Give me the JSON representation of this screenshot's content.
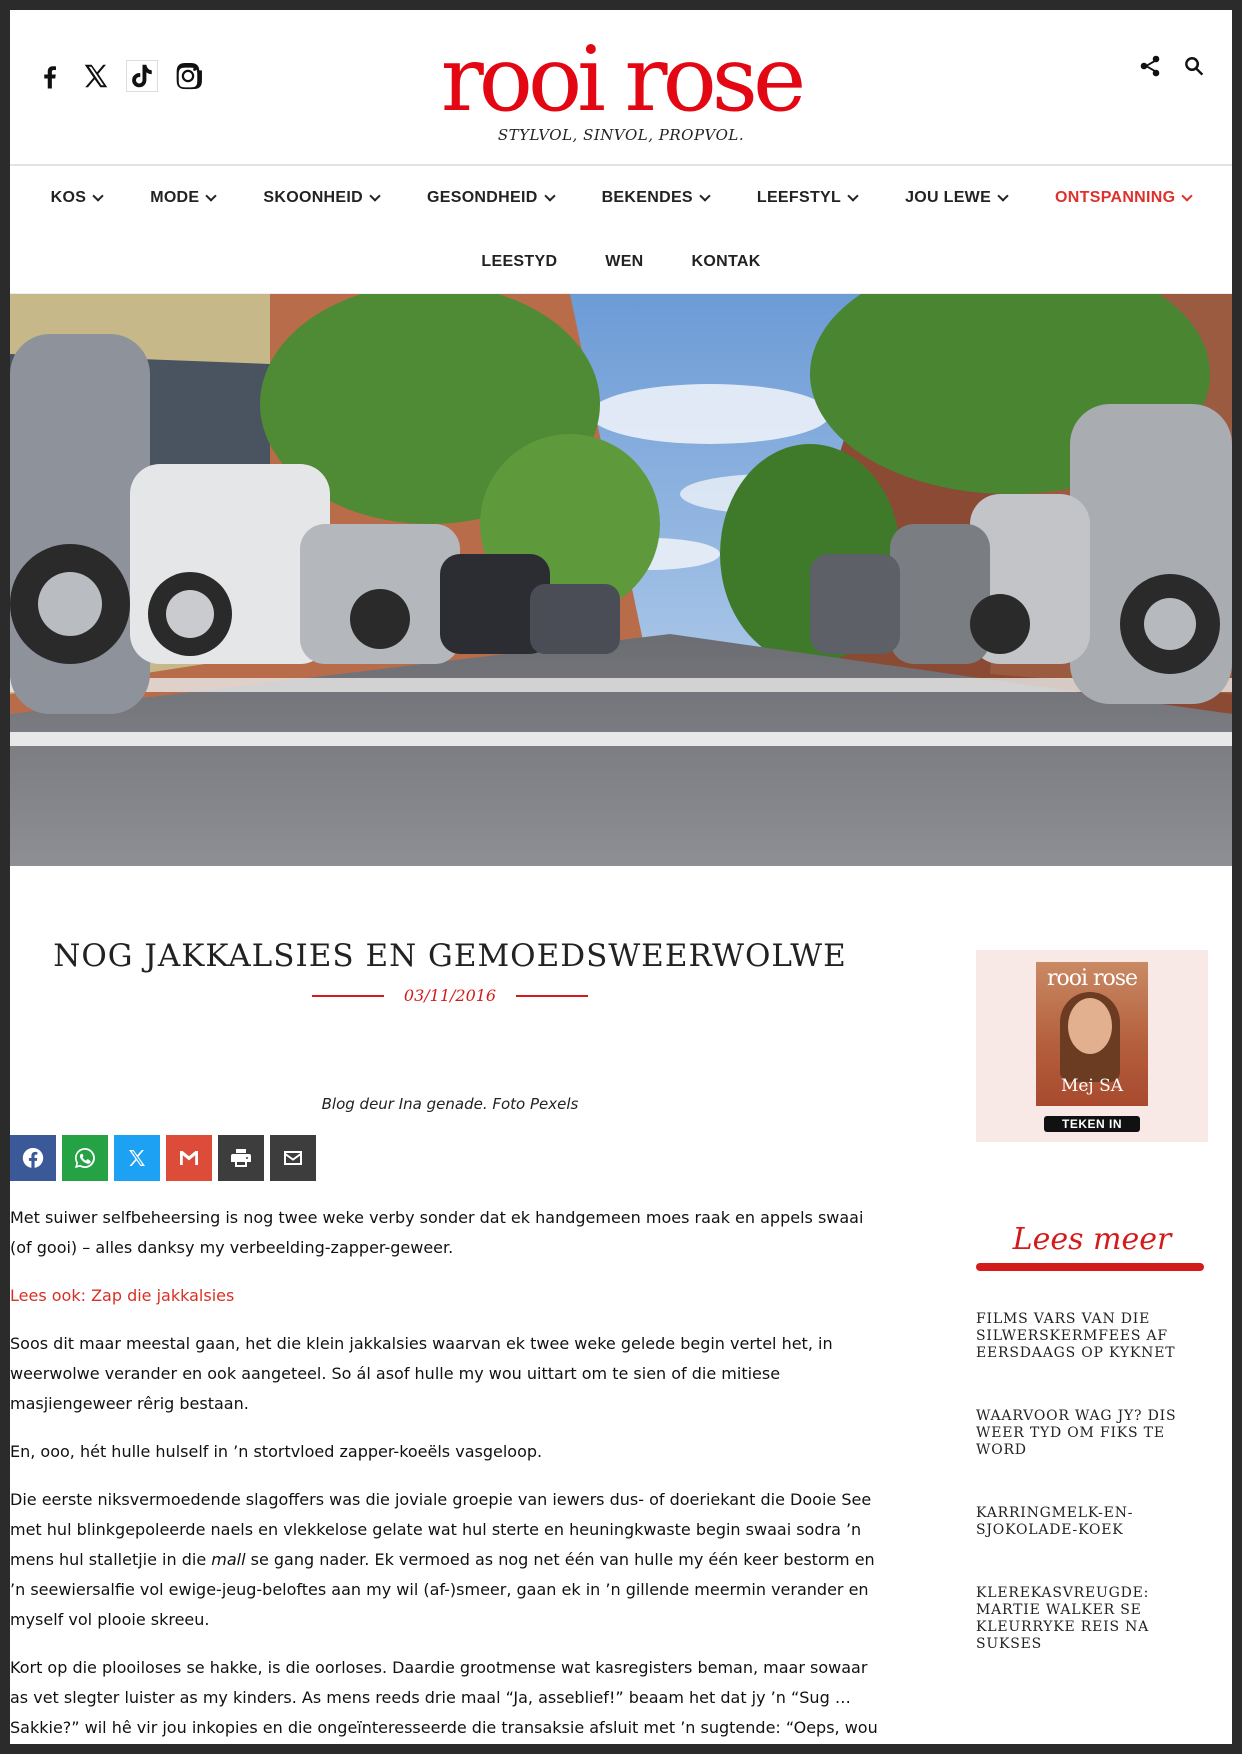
{
  "brand": {
    "logo": "rooi rose",
    "tagline": "STYLVOL, SINVOL, PROPVOL.",
    "accent": "#e30613"
  },
  "social_icons": [
    "facebook-icon",
    "x-icon",
    "tiktok-icon",
    "instagram-icon"
  ],
  "tools": [
    "share-icon",
    "search-icon"
  ],
  "nav": {
    "row1": [
      {
        "label": "KOS",
        "dropdown": true
      },
      {
        "label": "MODE",
        "dropdown": true
      },
      {
        "label": "SKOONHEID",
        "dropdown": true
      },
      {
        "label": "GESONDHEID",
        "dropdown": true
      },
      {
        "label": "BEKENDES",
        "dropdown": true
      },
      {
        "label": "LEEFSTYL",
        "dropdown": true
      },
      {
        "label": "JOU LEWE",
        "dropdown": true
      },
      {
        "label": "ONTSPANNING",
        "dropdown": true,
        "active": true
      }
    ],
    "row2": [
      {
        "label": "LEESTYD"
      },
      {
        "label": "WEN"
      },
      {
        "label": "KONTAK"
      }
    ]
  },
  "article": {
    "title": "NOG JAKKALSIES EN GEMOEDSWEERWOLWE",
    "date": "03/11/2016",
    "caption": "Blog deur Ina genade. Foto Pexels",
    "share_buttons": [
      {
        "name": "facebook",
        "color": "#3b5998"
      },
      {
        "name": "whatsapp",
        "color": "#25a244"
      },
      {
        "name": "x",
        "color": "#1da1f2"
      },
      {
        "name": "gmail",
        "color": "#dd4b39"
      },
      {
        "name": "print",
        "color": "#3d3d3d"
      },
      {
        "name": "email",
        "color": "#3d3d3d"
      }
    ],
    "paragraphs": {
      "p1": "Met suiwer selfbeheersing is nog twee weke verby sonder dat ek handgemeen moes raak en appels swaai (of gooi) – alles danksy my verbeelding-zapper-geweer.",
      "readalso": "Lees ook: Zap die jakkalsies",
      "p2": "Soos dit maar meestal gaan, het die klein jakkalsies waarvan ek twee weke gelede begin vertel het, in weerwolwe verander en ook aangeteel. So ál asof hulle my wou uittart om te sien of die mitiese masjiengeweer rêrig bestaan.",
      "p3": "En, ooo, hét hulle hulself in ’n stortvloed zapper-koeëls vasgeloop.",
      "p4a": "Die eerste niksvermoedende slagoffers was die joviale groepie van iewers dus- of doeriekant die Dooie See met hul blinkgepoleerde naels en vlekkelose gelate wat hul sterte en heuningkwaste begin swaai sodra ’n mens hul stalletjie in die ",
      "p4_em": "mall",
      "p4b": " se gang nader. Ek vermoed as nog net één van hulle my één keer bestorm en ’n seewiersalfie vol ewige-jeug-beloftes aan my wil (af-)smeer, gaan ek in ’n gillende meermin verander en myself vol plooie skreeu.",
      "p5": "Kort op die plooiloses se hakke, is die oorloses. Daardie grootmense wat kasregisters beman, maar sowaar as vet slegter luister as my kinders. As mens reeds drie maal “Ja, asseblief!” beaam het dat jy ’n “Sug … Sakkie?” wil hê vir jou inkopies en die ongeïnteresseerde die transaksie afsluit met ’n sugtende: “Oeps, wou"
    }
  },
  "sidebar": {
    "magazine": {
      "logo": "rooi rose",
      "cover_name": "Mej SA",
      "button": "TEKEN IN"
    },
    "lees_meer": "Lees meer",
    "related": [
      "FILMS VARS VAN DIE SILWERSKERMFEES AF EERSDAAGS OP KYKNET",
      "WAARVOOR WAG JY? DIS WEER TYD OM FIKS TE WORD",
      "KARRINGMELK-EN-SJOKOLADE-KOEK",
      "KLEREKASVREUGDE: MARTIE WALKER SE KLEURRYKE REIS NA SUKSES"
    ]
  }
}
